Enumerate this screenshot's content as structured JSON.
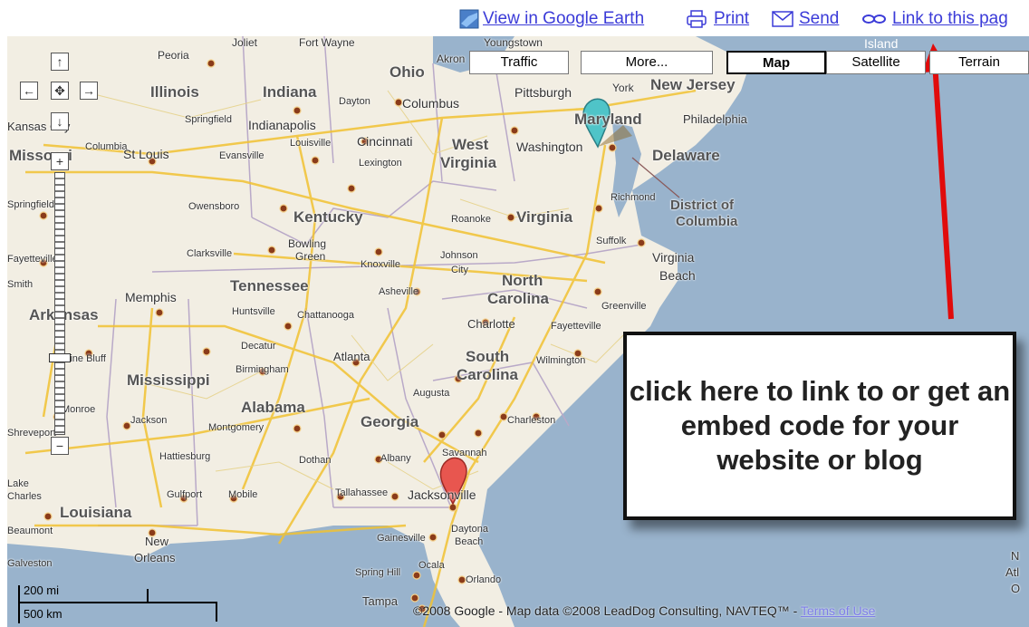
{
  "header": {
    "google_earth": "View in Google Earth",
    "print": "Print",
    "send": "Send",
    "link": "Link to this pag"
  },
  "maptypes": {
    "traffic": "Traffic",
    "more": "More...",
    "map": "Map",
    "satellite": "Satellite",
    "terrain": "Terrain"
  },
  "controls": {
    "pan_up": "↑",
    "pan_left": "←",
    "center": "✥",
    "pan_right": "→",
    "pan_down": "↓",
    "zoom_in": "+",
    "zoom_out": "−"
  },
  "callout": {
    "text": "click here to link to or get an embed code for your website or blog"
  },
  "scale": {
    "miles": "200 mi",
    "km": "500 km"
  },
  "copyright": {
    "text": "©2008 Google - Map data ©2008 LeadDog Consulting, NAVTEQ™ - ",
    "terms": "Terms of Use"
  },
  "states": {
    "ohio": "Ohio",
    "illinois": "Illinois",
    "indiana": "Indiana",
    "west_virginia_1": "West",
    "west_virginia_2": "Virginia",
    "maryland": "Maryland",
    "new_jersey": "New Jersey",
    "delaware": "Delaware",
    "missouri": "Missouri",
    "kentucky": "Kentucky",
    "virginia": "Virginia",
    "dc_1": "District of",
    "dc_2": "Columbia",
    "tennessee": "Tennessee",
    "north_carolina_1": "North",
    "north_carolina_2": "Carolina",
    "arkansas": "Arkansas",
    "south_carolina_1": "South",
    "south_carolina_2": "Carolina",
    "mississippi": "Mississippi",
    "alabama": "Alabama",
    "georgia": "Georgia",
    "louisiana": "Louisiana",
    "island": "Island"
  },
  "cities": {
    "peoria": "Peoria",
    "joliet": "Joliet",
    "fort_wayne": "Fort Wayne",
    "akron": "Akron",
    "youngstown": "Youngstown",
    "pittsburgh": "Pittsburgh",
    "york": "York",
    "philadelphia": "Philadelphia",
    "kansas_city": "Kansas City",
    "springfield": "Springfield",
    "indianapolis": "Indianapolis",
    "dayton": "Dayton",
    "columbus": "Columbus",
    "cincinnati": "Cincinnati",
    "washington": "Washington",
    "columbia_mo": "Columbia",
    "st_louis": "St Louis",
    "evansville": "Evansville",
    "louisville": "Louisville",
    "lexington": "Lexington",
    "richmond": "Richmond",
    "springfield_mo": "Springfield",
    "owensboro": "Owensboro",
    "roanoke": "Roanoke",
    "bowling_green_1": "Bowling",
    "bowling_green_2": "Green",
    "suffolk": "Suffolk",
    "virginia_beach_1": "Virginia",
    "virginia_beach_2": "Beach",
    "clarksville": "Clarksville",
    "knoxville": "Knoxville",
    "johnson_city_1": "Johnson",
    "johnson_city_2": "City",
    "fayetteville_ar": "Fayetteville",
    "smith": "Smith",
    "asheville": "Asheville",
    "greenville": "Greenville",
    "memphis": "Memphis",
    "huntsville": "Huntsville",
    "chattanooga": "Chattanooga",
    "charlotte": "Charlotte",
    "fayetteville_nc": "Fayetteville",
    "decatur": "Decatur",
    "atlanta": "Atlanta",
    "wilmington": "Wilmington",
    "pine_bluff": "Pine Bluff",
    "birmingham": "Birmingham",
    "augusta": "Augusta",
    "monroe": "Monroe",
    "jackson": "Jackson",
    "montgomery": "Montgomery",
    "charleston": "Charleston",
    "shreveport": "Shreveport",
    "savannah": "Savannah",
    "hattiesburg": "Hattiesburg",
    "dothan": "Dothan",
    "albany": "Albany",
    "lake_charles_1": "Lake",
    "lake_charles_2": "Charles",
    "gulfport": "Gulfport",
    "mobile": "Mobile",
    "tallahassee": "Tallahassee",
    "jacksonville": "Jacksonville",
    "beaumont": "Beaumont",
    "daytona_1": "Daytona",
    "daytona_2": "Beach",
    "new_orleans_1": "New",
    "new_orleans_2": "Orleans",
    "gainesville": "Gainesville",
    "galveston": "Galveston",
    "spring_hill": "Spring Hill",
    "ocala": "Ocala",
    "orlando": "Orlando",
    "tampa": "Tampa",
    "n_edge": "N",
    "atl_edge": "Atl",
    "o_edge": "O"
  }
}
